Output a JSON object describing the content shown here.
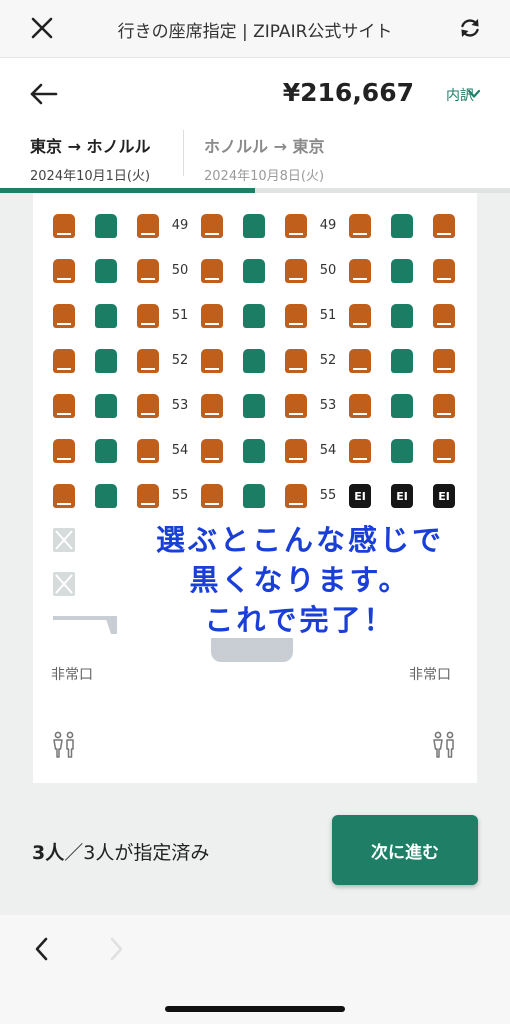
{
  "topbar": {
    "title": "行きの座席指定 | ZIPAIR公式サイト"
  },
  "header": {
    "price": "¥216,667",
    "breakdown_label": "内訳"
  },
  "legs": [
    {
      "route": "東京 → ホノルル",
      "date": "2024年10月1日(火)",
      "active": true
    },
    {
      "route": "ホノルル → 東京",
      "date": "2024年10月8日(火)",
      "active": false
    }
  ],
  "leg_progress": 0.5,
  "seat_rows": [
    {
      "row": "49",
      "seats": [
        "orange",
        "green",
        "orange",
        "orange",
        "green",
        "orange",
        "orange",
        "green",
        "orange"
      ]
    },
    {
      "row": "50",
      "seats": [
        "orange",
        "green",
        "orange",
        "orange",
        "green",
        "orange",
        "orange",
        "green",
        "orange"
      ]
    },
    {
      "row": "51",
      "seats": [
        "orange",
        "green",
        "orange",
        "orange",
        "green",
        "orange",
        "orange",
        "green",
        "orange"
      ]
    },
    {
      "row": "52",
      "seats": [
        "orange",
        "green",
        "orange",
        "orange",
        "green",
        "orange",
        "orange",
        "green",
        "orange"
      ]
    },
    {
      "row": "53",
      "seats": [
        "orange",
        "green",
        "orange",
        "orange",
        "green",
        "orange",
        "orange",
        "green",
        "orange"
      ]
    },
    {
      "row": "54",
      "seats": [
        "orange",
        "green",
        "orange",
        "orange",
        "green",
        "orange",
        "orange",
        "green",
        "orange"
      ]
    },
    {
      "row": "55",
      "seats": [
        "orange",
        "green",
        "orange",
        "orange",
        "green",
        "orange",
        "selected",
        "selected",
        "selected"
      ]
    }
  ],
  "selected_seat_label": "EI",
  "blocked_seats_count": 2,
  "exit": {
    "left_label": "非常口",
    "right_label": "非常口"
  },
  "annotation": {
    "lines": [
      "選ぶとこんな感じで",
      "黒くなります。",
      "これで完了！"
    ],
    "color": "#1a3fd8"
  },
  "footer": {
    "count_strong": "3人",
    "count_rest": "／3人が指定済み",
    "next_button": "次に進む"
  },
  "colors": {
    "accent": "#1e7e66",
    "seat_available": "#c05e1c",
    "seat_green": "#1b7d64",
    "seat_selected": "#161616"
  },
  "icons": [
    "close-icon",
    "reload-icon",
    "back-arrow-icon",
    "chevron-down-icon",
    "lavatory-icon",
    "nav-back-icon",
    "nav-forward-icon"
  ]
}
